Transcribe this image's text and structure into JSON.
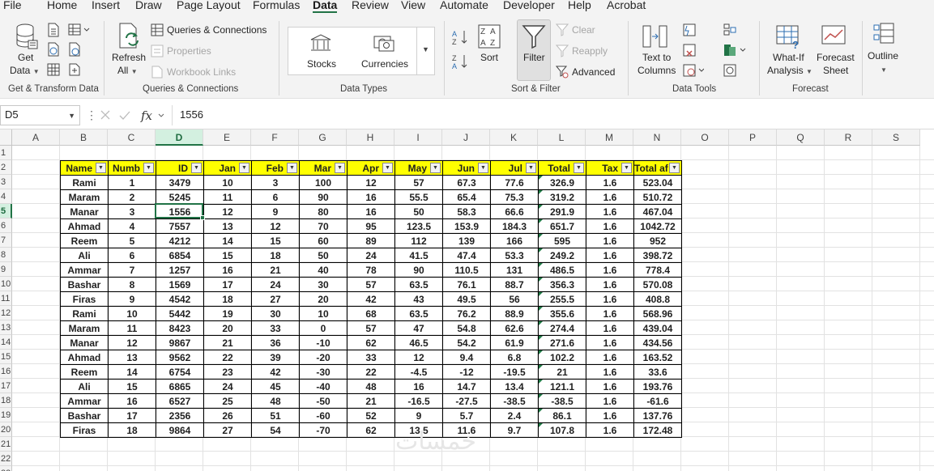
{
  "menu": [
    "File",
    "Home",
    "Insert",
    "Draw",
    "Page Layout",
    "Formulas",
    "Data",
    "Review",
    "View",
    "Automate",
    "Developer",
    "Help",
    "Acrobat"
  ],
  "menu_active": "Data",
  "accent_color": "#217346",
  "ribbon": {
    "get_data": [
      "Get",
      "Data"
    ],
    "get_transform_label": "Get & Transform Data",
    "refresh_all": [
      "Refresh",
      "All"
    ],
    "queries_connections": "Queries & Connections",
    "properties": "Properties",
    "workbook_links": "Workbook Links",
    "queries_group_label": "Queries & Connections",
    "stocks": "Stocks",
    "currencies": "Currencies",
    "data_types_label": "Data Types",
    "sort": "Sort",
    "filter": "Filter",
    "clear": "Clear",
    "reapply": "Reapply",
    "advanced": "Advanced",
    "sort_filter_label": "Sort & Filter",
    "text_to_columns": [
      "Text to",
      "Columns"
    ],
    "data_tools_label": "Data Tools",
    "what_if": [
      "What-If",
      "Analysis"
    ],
    "forecast_sheet": [
      "Forecast",
      "Sheet"
    ],
    "forecast_label": "Forecast",
    "outline": "Outline"
  },
  "formula_bar": {
    "name_box": "D5",
    "formula": "1556"
  },
  "columns": [
    "A",
    "B",
    "C",
    "D",
    "E",
    "F",
    "G",
    "H",
    "I",
    "J",
    "K",
    "L",
    "M",
    "N",
    "O",
    "P",
    "Q",
    "R",
    "S"
  ],
  "rows": [
    "1",
    "2",
    "3",
    "4",
    "5",
    "6",
    "7",
    "8",
    "9",
    "10",
    "11",
    "12",
    "13",
    "14",
    "15",
    "16",
    "17",
    "18",
    "19",
    "20",
    "21",
    "22",
    "23"
  ],
  "selected_cell": "D5",
  "table": {
    "headers": [
      "Name",
      "Numb",
      "ID",
      "Jan",
      "Feb",
      "Mar",
      "Apr",
      "May",
      "Jun",
      "Jul",
      "Total",
      "Tax",
      "Total af"
    ],
    "rows": [
      [
        "Rami",
        "1",
        "3479",
        "10",
        "3",
        "100",
        "12",
        "57",
        "67.3",
        "77.6",
        "326.9",
        "1.6",
        "523.04"
      ],
      [
        "Maram",
        "2",
        "5245",
        "11",
        "6",
        "90",
        "16",
        "55.5",
        "65.4",
        "75.3",
        "319.2",
        "1.6",
        "510.72"
      ],
      [
        "Manar",
        "3",
        "1556",
        "12",
        "9",
        "80",
        "16",
        "50",
        "58.3",
        "66.6",
        "291.9",
        "1.6",
        "467.04"
      ],
      [
        "Ahmad",
        "4",
        "7557",
        "13",
        "12",
        "70",
        "95",
        "123.5",
        "153.9",
        "184.3",
        "651.7",
        "1.6",
        "1042.72"
      ],
      [
        "Reem",
        "5",
        "4212",
        "14",
        "15",
        "60",
        "89",
        "112",
        "139",
        "166",
        "595",
        "1.6",
        "952"
      ],
      [
        "Ali",
        "6",
        "6854",
        "15",
        "18",
        "50",
        "24",
        "41.5",
        "47.4",
        "53.3",
        "249.2",
        "1.6",
        "398.72"
      ],
      [
        "Ammar",
        "7",
        "1257",
        "16",
        "21",
        "40",
        "78",
        "90",
        "110.5",
        "131",
        "486.5",
        "1.6",
        "778.4"
      ],
      [
        "Bashar",
        "8",
        "1569",
        "17",
        "24",
        "30",
        "57",
        "63.5",
        "76.1",
        "88.7",
        "356.3",
        "1.6",
        "570.08"
      ],
      [
        "Firas",
        "9",
        "4542",
        "18",
        "27",
        "20",
        "42",
        "43",
        "49.5",
        "56",
        "255.5",
        "1.6",
        "408.8"
      ],
      [
        "Rami",
        "10",
        "5442",
        "19",
        "30",
        "10",
        "68",
        "63.5",
        "76.2",
        "88.9",
        "355.6",
        "1.6",
        "568.96"
      ],
      [
        "Maram",
        "11",
        "8423",
        "20",
        "33",
        "0",
        "57",
        "47",
        "54.8",
        "62.6",
        "274.4",
        "1.6",
        "439.04"
      ],
      [
        "Manar",
        "12",
        "9867",
        "21",
        "36",
        "-10",
        "62",
        "46.5",
        "54.2",
        "61.9",
        "271.6",
        "1.6",
        "434.56"
      ],
      [
        "Ahmad",
        "13",
        "9562",
        "22",
        "39",
        "-20",
        "33",
        "12",
        "9.4",
        "6.8",
        "102.2",
        "1.6",
        "163.52"
      ],
      [
        "Reem",
        "14",
        "6754",
        "23",
        "42",
        "-30",
        "22",
        "-4.5",
        "-12",
        "-19.5",
        "21",
        "1.6",
        "33.6"
      ],
      [
        "Ali",
        "15",
        "6865",
        "24",
        "45",
        "-40",
        "48",
        "16",
        "14.7",
        "13.4",
        "121.1",
        "1.6",
        "193.76"
      ],
      [
        "Ammar",
        "16",
        "6527",
        "25",
        "48",
        "-50",
        "21",
        "-16.5",
        "-27.5",
        "-38.5",
        "-38.5",
        "1.6",
        "-61.6"
      ],
      [
        "Bashar",
        "17",
        "2356",
        "26",
        "51",
        "-60",
        "52",
        "9",
        "5.7",
        "2.4",
        "86.1",
        "1.6",
        "137.76"
      ],
      [
        "Firas",
        "18",
        "9864",
        "27",
        "54",
        "-70",
        "62",
        "13.5",
        "11.6",
        "9.7",
        "107.8",
        "1.6",
        "172.48"
      ]
    ]
  },
  "watermark": "خمسات"
}
